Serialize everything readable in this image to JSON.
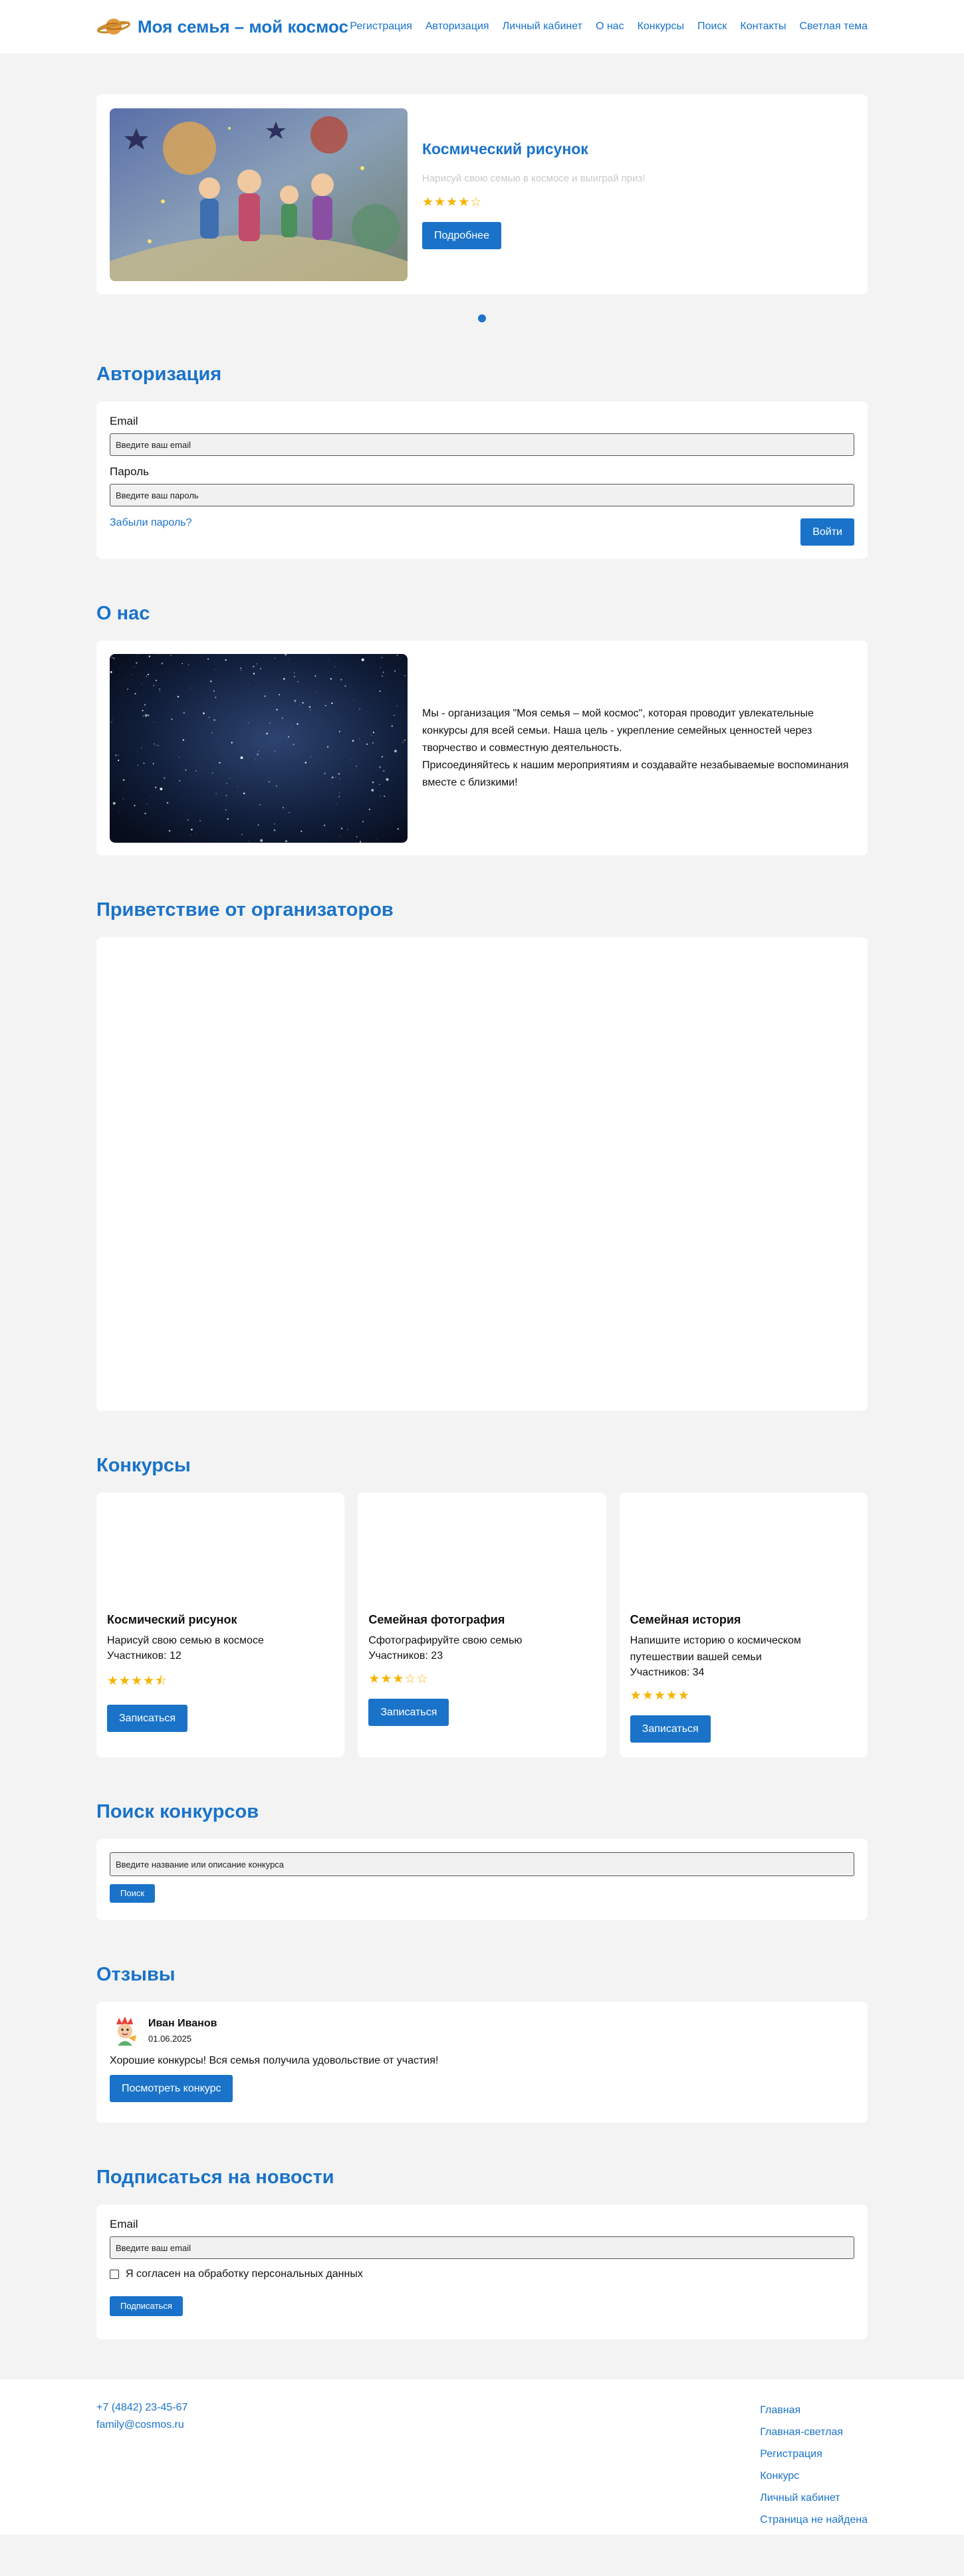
{
  "header": {
    "logo_text": "Моя семья – мой космос",
    "nav": [
      "Регистрация",
      "Авторизация",
      "Личный кабинет",
      "О нас",
      "Конкурсы",
      "Поиск",
      "Контакты",
      "Светлая тема"
    ]
  },
  "slider": {
    "title": "Космический рисунок",
    "description": "Нарисуй свою семью в космосе и выиграй приз!",
    "rating": 4,
    "stars": "★★★★☆",
    "button": "Подробнее"
  },
  "auth": {
    "title": "Авторизация",
    "email_label": "Email",
    "email_placeholder": "Введите ваш email",
    "password_label": "Пароль",
    "password_placeholder": "Введите ваш пароль",
    "forgot": "Забыли пароль?",
    "submit": "Войти"
  },
  "about": {
    "title": "О нас",
    "paragraph1": "Мы - организация \"Моя семья – мой космос\", которая проводит увлекательные конкурсы для всей семьи. Наша цель - укрепление семейных ценностей через творчество и совместную деятельность.",
    "paragraph2": "Присоединяйтесь к нашим мероприятиям и создавайте незабываемые воспоминания вместе с близкими!"
  },
  "greeting": {
    "title": "Приветствие от организаторов"
  },
  "contests": {
    "title": "Конкурсы",
    "items": [
      {
        "name": "Космический рисунок",
        "description": "Нарисуй свою семью в космосе",
        "participants": "Участников: 12",
        "rating": 4.5,
        "stars": "★★★★⯪",
        "button": "Записаться"
      },
      {
        "name": "Семейная фотография",
        "description": "Сфотографируйте свою семью",
        "participants": "Участников: 23",
        "rating": 3,
        "stars": "★★★☆☆",
        "button": "Записаться"
      },
      {
        "name": "Семейная история",
        "description": "Напишите историю о космическом путешествии вашей семьи",
        "participants": "Участников: 34",
        "rating": 5,
        "stars": "★★★★★",
        "button": "Записаться"
      }
    ]
  },
  "search": {
    "title": "Поиск конкурсов",
    "placeholder": "Введите название или описание конкурса",
    "button": "Поиск"
  },
  "reviews": {
    "title": "Отзывы",
    "name": "Иван Иванов",
    "date": "01.06.2025",
    "text": "Хорошие конкурсы! Вся семья получила удовольствие от участия!",
    "button": "Посмотреть конкурс"
  },
  "subscribe": {
    "title": "Подписаться на новости",
    "email_label": "Email",
    "email_placeholder": "Введите ваш email",
    "consent": "Я согласен на обработку персональных данных",
    "button": "Подписаться"
  },
  "footer": {
    "phone": "+7 (4842) 23-45-67",
    "email": "family@cosmos.ru",
    "links": [
      "Главная",
      "Главная-светлая",
      "Регистрация",
      "Конкурс",
      "Личный кабинет",
      "Страница не найдена"
    ]
  },
  "colors": {
    "accent": "#1a73c9",
    "star": "#f5b400",
    "background": "#f3f3f3"
  },
  "icons": {
    "logo": "planet-icon",
    "avatar": "cartoon-avatar-icon"
  }
}
